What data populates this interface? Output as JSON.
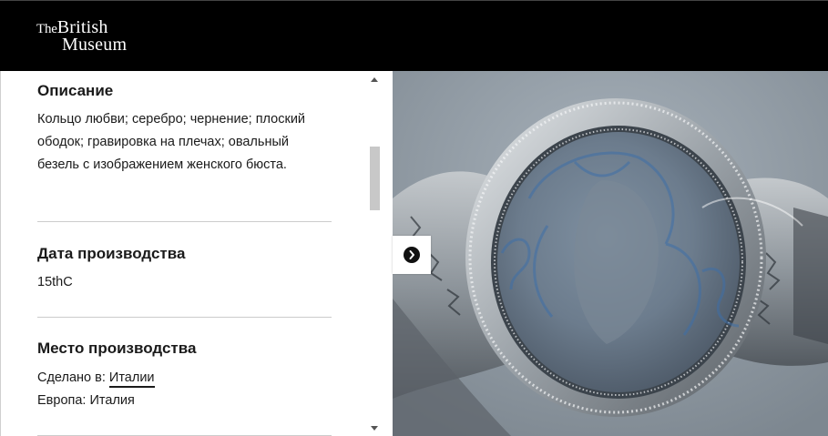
{
  "header": {
    "logo_the": "The",
    "logo_british": "British",
    "logo_museum": "Museum"
  },
  "description": {
    "title": "Описание",
    "text": "Кольцо любви; серебро; чернение; плоский ободок; гравировка на плечах; овальный безель с изображением женского бюста."
  },
  "production_date": {
    "title": "Дата производства",
    "value": "15thC"
  },
  "production_place": {
    "title": "Место производства",
    "made_in_label": "Сделано в:",
    "made_in_link": "Италии",
    "region_line": "Европа: Италия"
  },
  "image_viewer": {
    "next_icon": "chevron-right-circle-icon",
    "subject": "silver niello ring with oval bezel"
  },
  "colors": {
    "header_bg": "#000000",
    "text": "#1a1a1a",
    "divider": "#cccccc"
  }
}
